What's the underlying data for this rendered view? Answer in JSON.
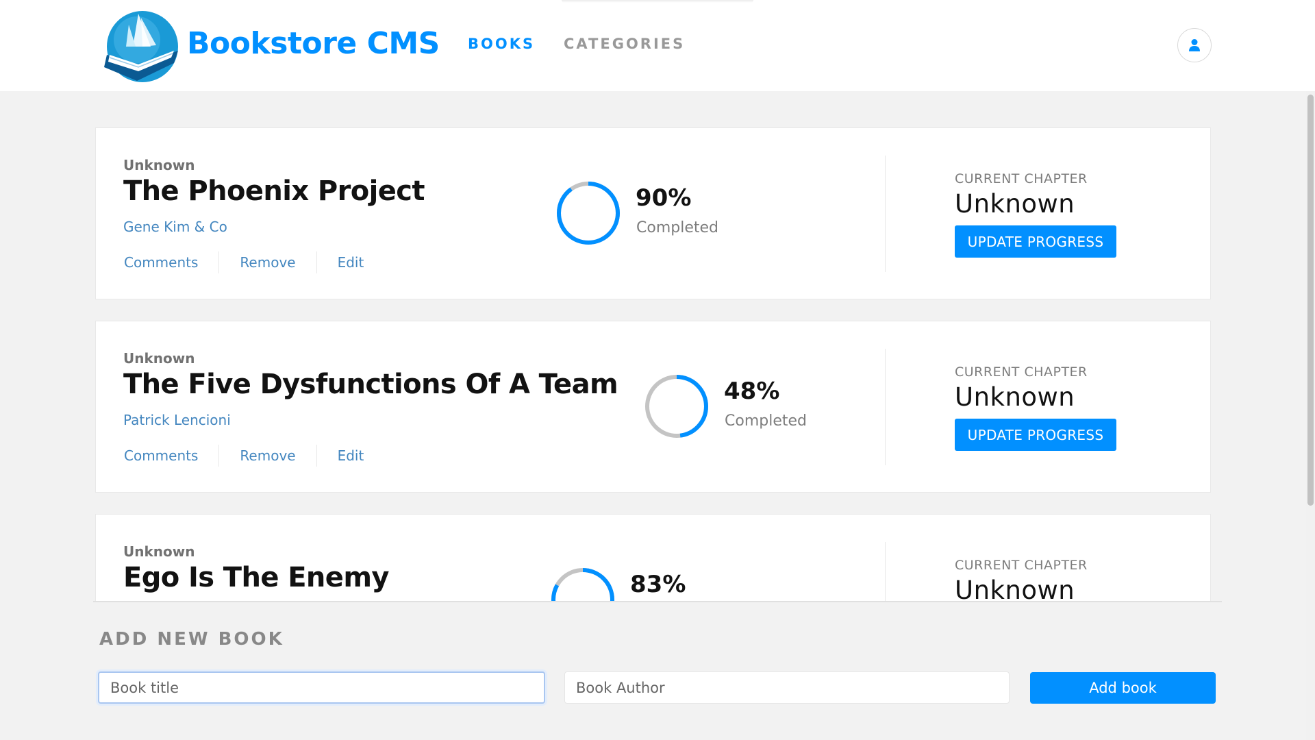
{
  "header": {
    "brand": "Bookstore CMS",
    "nav": [
      {
        "label": "BOOKS",
        "active": true
      },
      {
        "label": "CATEGORIES",
        "active": false
      }
    ],
    "user_icon": "user-icon",
    "accent_color": "#0290ff"
  },
  "books": [
    {
      "genre": "Unknown",
      "title": "The Phoenix Project",
      "author": "Gene Kim & Co",
      "actions": [
        "Comments",
        "Remove",
        "Edit"
      ],
      "progress_percent": 90,
      "progress_text": "90%",
      "completed_label": "Completed",
      "chapter_label": "CURRENT CHAPTER",
      "chapter": "Unknown",
      "update_label": "UPDATE PROGRESS"
    },
    {
      "genre": "Unknown",
      "title": "The Five Dysfunctions Of A Team",
      "author": "Patrick Lencioni",
      "actions": [
        "Comments",
        "Remove",
        "Edit"
      ],
      "progress_percent": 48,
      "progress_text": "48%",
      "completed_label": "Completed",
      "chapter_label": "CURRENT CHAPTER",
      "chapter": "Unknown",
      "update_label": "UPDATE PROGRESS"
    },
    {
      "genre": "Unknown",
      "title": "Ego Is The Enemy",
      "progress_percent": 83,
      "progress_text": "83%",
      "chapter_label": "CURRENT CHAPTER",
      "chapter": "Unknown"
    }
  ],
  "form": {
    "heading": "ADD NEW BOOK",
    "title_placeholder": "Book title",
    "author_placeholder": "Book Author",
    "submit_label": "Add book"
  },
  "colors": {
    "ring_track": "#c4c4c4",
    "ring_fill": "#0290ff",
    "link": "#4386bf"
  }
}
